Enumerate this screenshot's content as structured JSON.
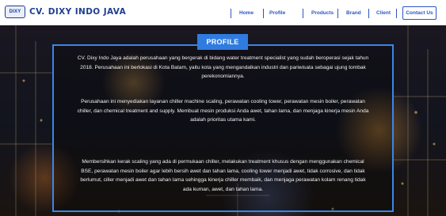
{
  "header": {
    "logo_mark": "DIXY",
    "logo_text": "CV. DIXY INDO JAVA",
    "nav": [
      "Home",
      "Profile",
      "Products",
      "Brand",
      "Client"
    ],
    "contact_label": "Contact Us"
  },
  "profile": {
    "title": "PROFILE",
    "paragraphs": [
      "CV. Dixy Indo Jaya adalah perusahaan yang bergerak di bidang water treatment specialist yang sudah beroperasi sejak tahun 2018. Perusahaan ini berlokasi di Kota Batam, yaitu kota yang mengandalkan industri dan pariwisata sebagai ujung tombak perekonomiannya.",
      "Perusahaan ini menyediakan layanan chiller machine scaling, perawatan cooling tower, perawatan mesin boiler, perawatan chiller, dan chemical treatment and supply. Membuat mesin produksi Anda awet, tahan lama, dan menjaga kinerja mesin Anda adalah prioritas utama kami.",
      "Membersihkan kerak scaling yang ada di permukaan chiller, melakukan treatment khusus dengan menggunakan chemical BSE, perawatan mesin boiler agar lebih bersih awet dan tahan lama, cooling tower menjadi awet, tidak corrosive, dan tidak berlumut, ciller menjadi awet dan tahan lama sehingga kinerja chiller membaik, dan menjaga perawatan kolam renang tidak ada kuman, awet, dan tahan lama."
    ]
  },
  "colors": {
    "brand_blue": "#1f3f8f",
    "nav_blue": "#2a55c7",
    "accent_blue": "#2f7be0",
    "frame_blue": "#3a86e8"
  }
}
